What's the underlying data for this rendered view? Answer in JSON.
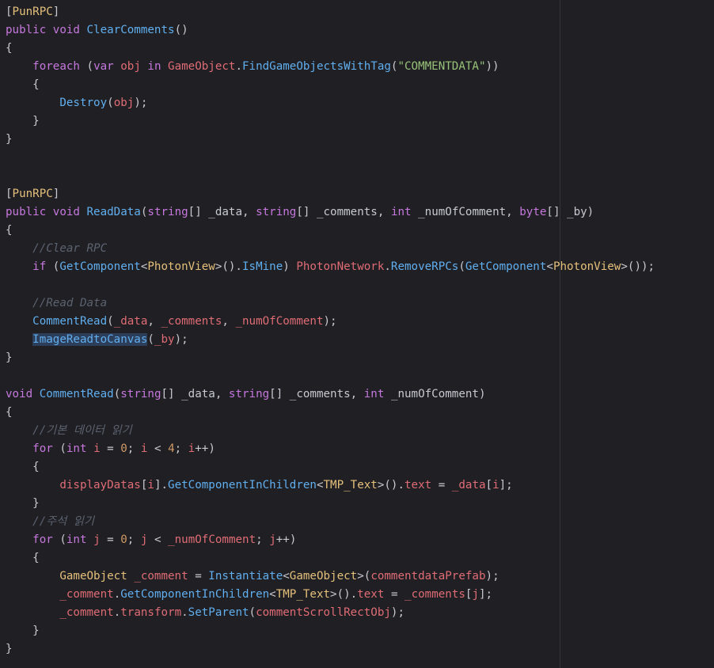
{
  "editor": {
    "lines": [
      [
        {
          "t": "[",
          "c": "pn"
        },
        {
          "t": "PunRPC",
          "c": "attr"
        },
        {
          "t": "]",
          "c": "pn"
        }
      ],
      [
        {
          "t": "public ",
          "c": "kw"
        },
        {
          "t": "void ",
          "c": "kw"
        },
        {
          "t": "ClearComments",
          "c": "fn"
        },
        {
          "t": "()",
          "c": "pn"
        }
      ],
      [
        {
          "t": "{",
          "c": "pn"
        }
      ],
      [
        {
          "t": "    ",
          "c": "pn"
        },
        {
          "t": "foreach ",
          "c": "kw"
        },
        {
          "t": "(",
          "c": "pn"
        },
        {
          "t": "var ",
          "c": "kw"
        },
        {
          "t": "obj ",
          "c": "var"
        },
        {
          "t": "in ",
          "c": "kw"
        },
        {
          "t": "GameObject",
          "c": "var"
        },
        {
          "t": ".",
          "c": "pn"
        },
        {
          "t": "FindGameObjectsWithTag",
          "c": "fn"
        },
        {
          "t": "(",
          "c": "pn"
        },
        {
          "t": "\"COMMENTDATA\"",
          "c": "str"
        },
        {
          "t": "))",
          "c": "pn"
        }
      ],
      [
        {
          "t": "    {",
          "c": "pn"
        }
      ],
      [
        {
          "t": "        ",
          "c": "pn"
        },
        {
          "t": "Destroy",
          "c": "fn"
        },
        {
          "t": "(",
          "c": "pn"
        },
        {
          "t": "obj",
          "c": "var"
        },
        {
          "t": ");",
          "c": "pn"
        }
      ],
      [
        {
          "t": "    }",
          "c": "pn"
        }
      ],
      [
        {
          "t": "}",
          "c": "pn"
        }
      ],
      [],
      [],
      [
        {
          "t": "[",
          "c": "pn"
        },
        {
          "t": "PunRPC",
          "c": "attr"
        },
        {
          "t": "]",
          "c": "pn"
        }
      ],
      [
        {
          "t": "public ",
          "c": "kw"
        },
        {
          "t": "void ",
          "c": "kw"
        },
        {
          "t": "ReadData",
          "c": "fn"
        },
        {
          "t": "(",
          "c": "pn"
        },
        {
          "t": "string",
          "c": "kw"
        },
        {
          "t": "[] ",
          "c": "pn"
        },
        {
          "t": "_data",
          "c": "pn"
        },
        {
          "t": ", ",
          "c": "pn"
        },
        {
          "t": "string",
          "c": "kw"
        },
        {
          "t": "[] ",
          "c": "pn"
        },
        {
          "t": "_comments",
          "c": "pn"
        },
        {
          "t": ", ",
          "c": "pn"
        },
        {
          "t": "int ",
          "c": "kw"
        },
        {
          "t": "_numOfComment",
          "c": "pn"
        },
        {
          "t": ", ",
          "c": "pn"
        },
        {
          "t": "byte",
          "c": "kw"
        },
        {
          "t": "[] ",
          "c": "pn"
        },
        {
          "t": "_by",
          "c": "pn"
        },
        {
          "t": ")",
          "c": "pn"
        }
      ],
      [
        {
          "t": "{",
          "c": "pn"
        }
      ],
      [
        {
          "t": "    ",
          "c": "pn"
        },
        {
          "t": "//Clear RPC",
          "c": "cm"
        }
      ],
      [
        {
          "t": "    ",
          "c": "pn"
        },
        {
          "t": "if ",
          "c": "kw"
        },
        {
          "t": "(",
          "c": "pn"
        },
        {
          "t": "GetComponent",
          "c": "fn"
        },
        {
          "t": "<",
          "c": "pn"
        },
        {
          "t": "PhotonView",
          "c": "ty"
        },
        {
          "t": ">().",
          "c": "pn"
        },
        {
          "t": "IsMine",
          "c": "fn"
        },
        {
          "t": ") ",
          "c": "pn"
        },
        {
          "t": "PhotonNetwork",
          "c": "var"
        },
        {
          "t": ".",
          "c": "pn"
        },
        {
          "t": "RemoveRPCs",
          "c": "fn"
        },
        {
          "t": "(",
          "c": "pn"
        },
        {
          "t": "GetComponent",
          "c": "fn"
        },
        {
          "t": "<",
          "c": "pn"
        },
        {
          "t": "PhotonView",
          "c": "ty"
        },
        {
          "t": ">());",
          "c": "pn"
        }
      ],
      [],
      [
        {
          "t": "    ",
          "c": "pn"
        },
        {
          "t": "//Read Data",
          "c": "cm"
        }
      ],
      [
        {
          "t": "    ",
          "c": "pn"
        },
        {
          "t": "CommentRead",
          "c": "fn"
        },
        {
          "t": "(",
          "c": "pn"
        },
        {
          "t": "_data",
          "c": "var"
        },
        {
          "t": ", ",
          "c": "pn"
        },
        {
          "t": "_comments",
          "c": "var"
        },
        {
          "t": ", ",
          "c": "pn"
        },
        {
          "t": "_numOfComment",
          "c": "var"
        },
        {
          "t": ");",
          "c": "pn"
        }
      ],
      [
        {
          "t": "    ",
          "c": "pn"
        },
        {
          "t": "ImageReadtoCanvas",
          "c": "fn hl"
        },
        {
          "t": "(",
          "c": "pn"
        },
        {
          "t": "_by",
          "c": "var"
        },
        {
          "t": ");",
          "c": "pn"
        }
      ],
      [
        {
          "t": "}",
          "c": "pn"
        }
      ],
      [],
      [
        {
          "t": "void ",
          "c": "kw"
        },
        {
          "t": "CommentRead",
          "c": "fn"
        },
        {
          "t": "(",
          "c": "pn"
        },
        {
          "t": "string",
          "c": "kw"
        },
        {
          "t": "[] ",
          "c": "pn"
        },
        {
          "t": "_data",
          "c": "pn"
        },
        {
          "t": ", ",
          "c": "pn"
        },
        {
          "t": "string",
          "c": "kw"
        },
        {
          "t": "[] ",
          "c": "pn"
        },
        {
          "t": "_comments",
          "c": "pn"
        },
        {
          "t": ", ",
          "c": "pn"
        },
        {
          "t": "int ",
          "c": "kw"
        },
        {
          "t": "_numOfComment",
          "c": "pn"
        },
        {
          "t": ")",
          "c": "pn"
        }
      ],
      [
        {
          "t": "{",
          "c": "pn"
        }
      ],
      [
        {
          "t": "    ",
          "c": "pn"
        },
        {
          "t": "//기본 데이터 읽기",
          "c": "cm"
        }
      ],
      [
        {
          "t": "    ",
          "c": "pn"
        },
        {
          "t": "for ",
          "c": "kw"
        },
        {
          "t": "(",
          "c": "pn"
        },
        {
          "t": "int ",
          "c": "kw"
        },
        {
          "t": "i ",
          "c": "var"
        },
        {
          "t": "= ",
          "c": "pn"
        },
        {
          "t": "0",
          "c": "num"
        },
        {
          "t": "; ",
          "c": "pn"
        },
        {
          "t": "i ",
          "c": "var"
        },
        {
          "t": "< ",
          "c": "pn"
        },
        {
          "t": "4",
          "c": "num"
        },
        {
          "t": "; ",
          "c": "pn"
        },
        {
          "t": "i",
          "c": "var"
        },
        {
          "t": "++)",
          "c": "pn"
        }
      ],
      [
        {
          "t": "    {",
          "c": "pn"
        }
      ],
      [
        {
          "t": "        ",
          "c": "pn"
        },
        {
          "t": "displayDatas",
          "c": "var"
        },
        {
          "t": "[",
          "c": "pn"
        },
        {
          "t": "i",
          "c": "var"
        },
        {
          "t": "].",
          "c": "pn"
        },
        {
          "t": "GetComponentInChildren",
          "c": "fn"
        },
        {
          "t": "<",
          "c": "pn"
        },
        {
          "t": "TMP_Text",
          "c": "ty"
        },
        {
          "t": ">().",
          "c": "pn"
        },
        {
          "t": "text ",
          "c": "var"
        },
        {
          "t": "= ",
          "c": "pn"
        },
        {
          "t": "_data",
          "c": "var"
        },
        {
          "t": "[",
          "c": "pn"
        },
        {
          "t": "i",
          "c": "var"
        },
        {
          "t": "];",
          "c": "pn"
        }
      ],
      [
        {
          "t": "    }",
          "c": "pn"
        }
      ],
      [
        {
          "t": "    ",
          "c": "pn"
        },
        {
          "t": "//주석 읽기",
          "c": "cm"
        }
      ],
      [
        {
          "t": "    ",
          "c": "pn"
        },
        {
          "t": "for ",
          "c": "kw"
        },
        {
          "t": "(",
          "c": "pn"
        },
        {
          "t": "int ",
          "c": "kw"
        },
        {
          "t": "j ",
          "c": "var"
        },
        {
          "t": "= ",
          "c": "pn"
        },
        {
          "t": "0",
          "c": "num"
        },
        {
          "t": "; ",
          "c": "pn"
        },
        {
          "t": "j ",
          "c": "var"
        },
        {
          "t": "< ",
          "c": "pn"
        },
        {
          "t": "_numOfComment",
          "c": "var"
        },
        {
          "t": "; ",
          "c": "pn"
        },
        {
          "t": "j",
          "c": "var"
        },
        {
          "t": "++)",
          "c": "pn"
        }
      ],
      [
        {
          "t": "    {",
          "c": "pn"
        }
      ],
      [
        {
          "t": "        ",
          "c": "pn"
        },
        {
          "t": "GameObject ",
          "c": "ty"
        },
        {
          "t": "_comment ",
          "c": "var"
        },
        {
          "t": "= ",
          "c": "pn"
        },
        {
          "t": "Instantiate",
          "c": "fn"
        },
        {
          "t": "<",
          "c": "pn"
        },
        {
          "t": "GameObject",
          "c": "ty"
        },
        {
          "t": ">(",
          "c": "pn"
        },
        {
          "t": "commentdataPrefab",
          "c": "var"
        },
        {
          "t": ");",
          "c": "pn"
        }
      ],
      [
        {
          "t": "        ",
          "c": "pn"
        },
        {
          "t": "_comment",
          "c": "var"
        },
        {
          "t": ".",
          "c": "pn"
        },
        {
          "t": "GetComponentInChildren",
          "c": "fn"
        },
        {
          "t": "<",
          "c": "pn"
        },
        {
          "t": "TMP_Text",
          "c": "ty"
        },
        {
          "t": ">().",
          "c": "pn"
        },
        {
          "t": "text ",
          "c": "var"
        },
        {
          "t": "= ",
          "c": "pn"
        },
        {
          "t": "_comments",
          "c": "var"
        },
        {
          "t": "[",
          "c": "pn"
        },
        {
          "t": "j",
          "c": "var"
        },
        {
          "t": "];",
          "c": "pn"
        }
      ],
      [
        {
          "t": "        ",
          "c": "pn"
        },
        {
          "t": "_comment",
          "c": "var"
        },
        {
          "t": ".",
          "c": "pn"
        },
        {
          "t": "transform",
          "c": "var"
        },
        {
          "t": ".",
          "c": "pn"
        },
        {
          "t": "SetParent",
          "c": "fn"
        },
        {
          "t": "(",
          "c": "pn"
        },
        {
          "t": "commentScrollRectObj",
          "c": "var"
        },
        {
          "t": ");",
          "c": "pn"
        }
      ],
      [
        {
          "t": "    }",
          "c": "pn"
        }
      ],
      [
        {
          "t": "}",
          "c": "pn"
        }
      ]
    ]
  }
}
